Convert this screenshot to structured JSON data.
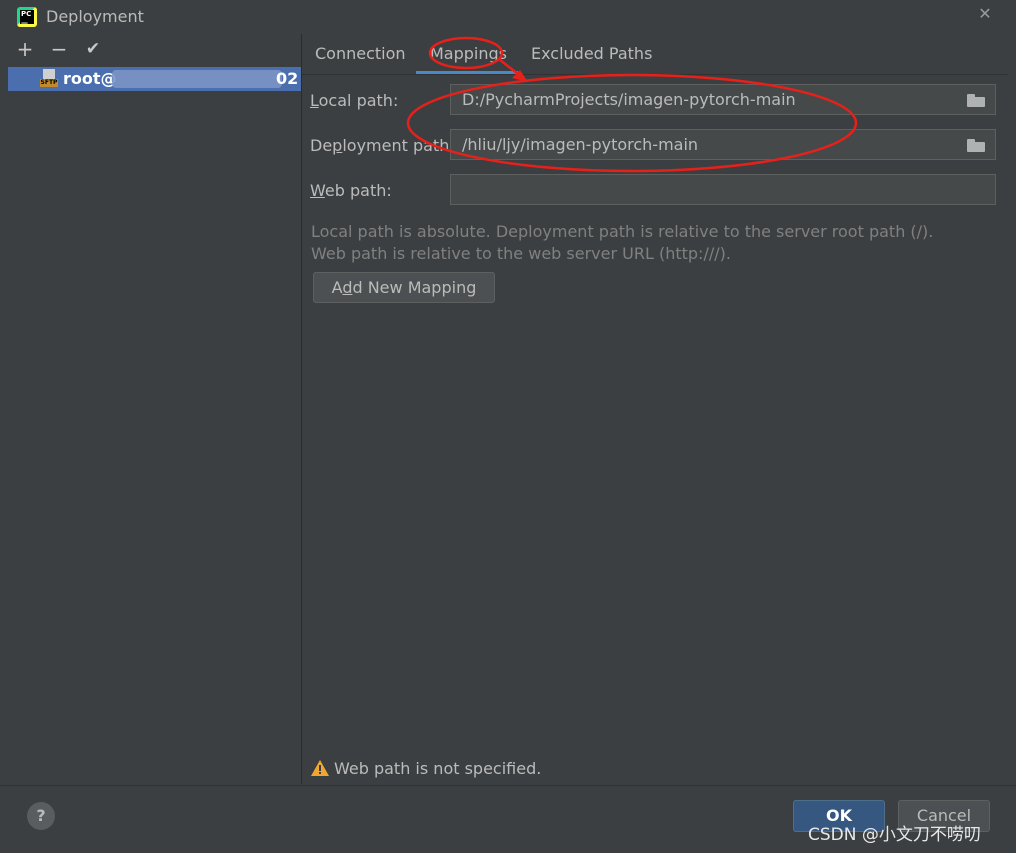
{
  "window": {
    "title": "Deployment",
    "close_glyph": "✕"
  },
  "left_panel": {
    "toolbar": {
      "add": "+",
      "remove": "−",
      "apply": "✔"
    },
    "server": {
      "type_badge": "SFTP",
      "name_prefix": "root@",
      "name_suffix": "02"
    }
  },
  "tabs": [
    {
      "label": "Connection",
      "active": false
    },
    {
      "label": "Mappings",
      "active": true
    },
    {
      "label": "Excluded Paths",
      "active": false
    }
  ],
  "mappings": {
    "local_path": {
      "label_mnemonic": "L",
      "label_rest": "ocal path:",
      "value": "D:/PycharmProjects/imagen-pytorch-main"
    },
    "deployment_path": {
      "label_pre": "De",
      "label_mnemonic": "p",
      "label_rest": "loyment path:",
      "value": "/hliu/ljy/imagen-pytorch-main"
    },
    "web_path": {
      "label_mnemonic": "W",
      "label_rest": "eb path:",
      "value": ""
    },
    "hint_line1": "Local path is absolute. Deployment path is relative to the server root path (/).",
    "hint_line2": "Web path is relative to the web server URL (http:///).",
    "add_button": {
      "pre": "A",
      "mnemonic": "d",
      "rest": "d New Mapping"
    }
  },
  "warning": {
    "icon": "warning-icon",
    "text": "Web path is not specified."
  },
  "footer": {
    "help": "?",
    "ok": "OK",
    "cancel": "Cancel"
  },
  "watermark": "CSDN @小文刀不唠叨",
  "colors": {
    "selection": "#4b6eaf",
    "accent": "#4a88c7",
    "annotation": "#e8201a"
  }
}
